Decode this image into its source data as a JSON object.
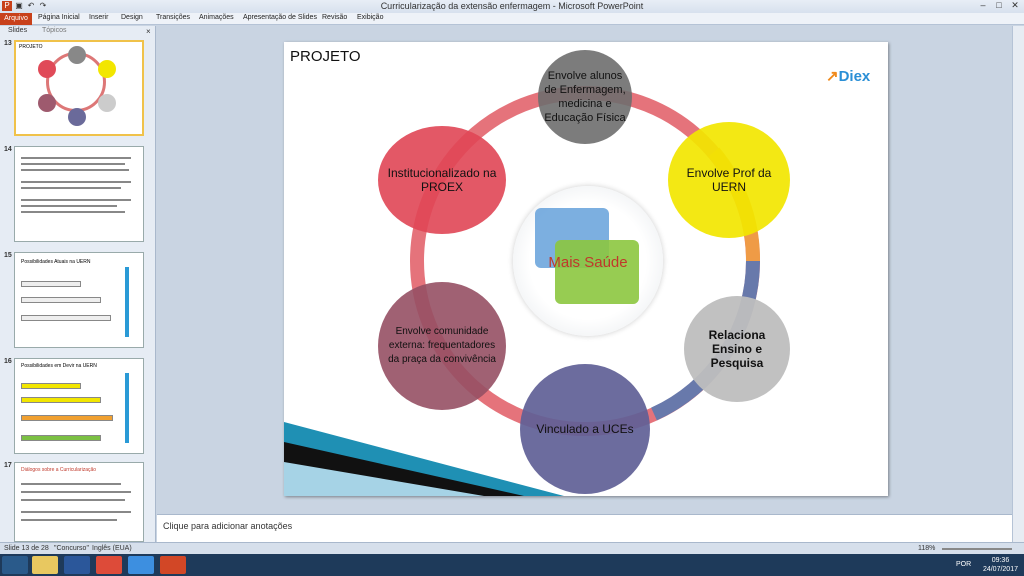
{
  "window": {
    "title": "Curricularização da extensão enfermagem - Microsoft PowerPoint"
  },
  "ribbon": {
    "tabs": [
      "Arquivo",
      "Página Inicial",
      "Inserir",
      "Design",
      "Transições",
      "Animações",
      "Apresentação de Slides",
      "Revisão",
      "Exibição"
    ]
  },
  "panel": {
    "tabs": [
      "Slides",
      "Tópicos"
    ],
    "close": "×"
  },
  "thumbnails": [
    {
      "num": "13",
      "text": "PROJETO"
    },
    {
      "num": "14",
      "text": ""
    },
    {
      "num": "15",
      "text": "Possibilidades Atuais na UERN"
    },
    {
      "num": "16",
      "text": "Possibilidades em Devir na UERN"
    },
    {
      "num": "17",
      "text": "Diálogos sobre a Curricularização"
    }
  ],
  "slide": {
    "title": "PROJETO",
    "logo": "Diex",
    "center": "Mais Saúde",
    "nodes": {
      "top": "Envolve alunos de Enfermagem, medicina e Educação Física",
      "right": "Envolve Prof da UERN",
      "lowright": "Relaciona Ensino e Pesquisa",
      "bottom": "Vinculado a UCEs",
      "lowleft": "Envolve comunidade externa: frequentadores da praça da convivência",
      "left": "Institucionalizado na PROEX"
    },
    "colors": {
      "top": "#7a7a7a",
      "right": "#f2e600",
      "lowright": "#c4c4c4",
      "bottom": "#6a6a9a",
      "lowleft": "#9e5a6e",
      "left": "#e04a58"
    }
  },
  "notes": {
    "placeholder": "Clique para adicionar anotações"
  },
  "status": {
    "slide": "Slide 13 de 28",
    "theme": "\"Concurso\"",
    "language": "Inglês (EUA)",
    "zoom": "118%"
  },
  "tray": {
    "lang": "POR",
    "time": "09:36",
    "date": "24/07/2017"
  }
}
